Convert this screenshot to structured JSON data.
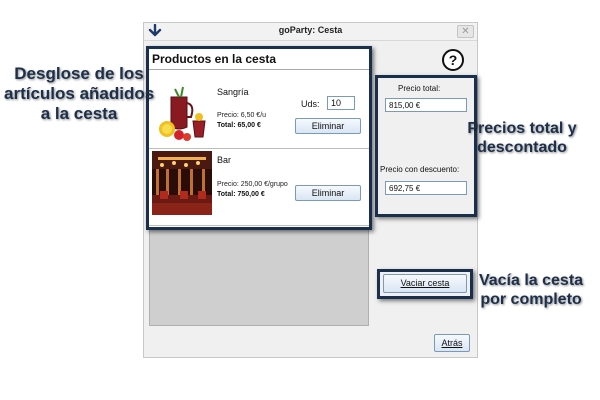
{
  "window": {
    "title": "goParty: Cesta",
    "close_label": "✕",
    "help_label": "?"
  },
  "products": {
    "header": "Productos en la cesta",
    "items": [
      {
        "name": "Sangría",
        "price": "Precio: 6,50 €/u",
        "total": "Total: 65,00 €",
        "remove_label": "Eliminar",
        "has_quantity": true,
        "image": "sangria-pitcher-image"
      },
      {
        "name": "Bar",
        "price": "Precio: 250,00 €/grupo",
        "total": "Total: 750,00 €",
        "remove_label": "Eliminar",
        "has_quantity": false,
        "image": "bar-interior-image"
      }
    ],
    "quantity": {
      "label": "Uds:",
      "value": "10"
    }
  },
  "prices": {
    "total_label": "Precio total:",
    "total_value": "815,00 €",
    "discount_label": "Precio con descuento:",
    "discount_value": "692,75 €"
  },
  "actions": {
    "clear_cart": "Vaciar cesta",
    "back": "Atrás"
  },
  "annotations": {
    "breakdown": [
      "Desglose de los",
      "artículos añadidos",
      "a la cesta"
    ],
    "prices": [
      "Precios total y",
      "descontado"
    ],
    "clear": [
      "Vacía la cesta",
      "por completo"
    ]
  },
  "colors": {
    "highlight_frame": "#1a2f4c",
    "annotation_text": "#1d2f4a",
    "button_border": "#7a9ab8"
  }
}
